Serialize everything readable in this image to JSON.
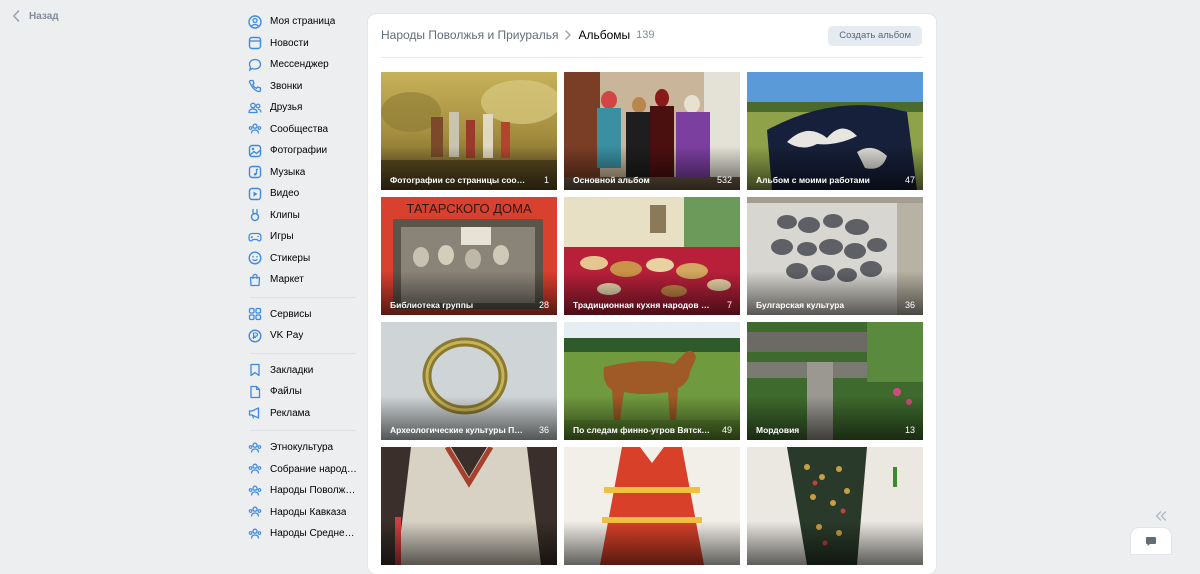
{
  "back": {
    "label": "Назад"
  },
  "sidebar": {
    "groups": [
      [
        {
          "label": "Моя страница",
          "icon": "user-circle-icon"
        },
        {
          "label": "Новости",
          "icon": "news-icon"
        },
        {
          "label": "Мессенджер",
          "icon": "message-icon"
        },
        {
          "label": "Звонки",
          "icon": "phone-icon"
        },
        {
          "label": "Друзья",
          "icon": "friends-icon"
        },
        {
          "label": "Сообщества",
          "icon": "communities-icon"
        },
        {
          "label": "Фотографии",
          "icon": "photo-icon"
        },
        {
          "label": "Музыка",
          "icon": "music-icon"
        },
        {
          "label": "Видео",
          "icon": "video-icon"
        },
        {
          "label": "Клипы",
          "icon": "clips-icon"
        },
        {
          "label": "Игры",
          "icon": "gamepad-icon"
        },
        {
          "label": "Стикеры",
          "icon": "smile-icon"
        },
        {
          "label": "Маркет",
          "icon": "shopping-bag-icon"
        }
      ],
      [
        {
          "label": "Сервисы",
          "icon": "services-icon"
        },
        {
          "label": "VK Pay",
          "icon": "vkpay-icon"
        }
      ],
      [
        {
          "label": "Закладки",
          "icon": "bookmark-icon"
        },
        {
          "label": "Файлы",
          "icon": "file-icon"
        },
        {
          "label": "Реклама",
          "icon": "megaphone-icon"
        }
      ],
      [
        {
          "label": "Этнокультура",
          "icon": "group-icon"
        },
        {
          "label": "Собрание народн...",
          "icon": "group-icon"
        },
        {
          "label": "Народы Поволжья...",
          "icon": "group-icon"
        },
        {
          "label": "Народы Кавказа",
          "icon": "group-icon"
        },
        {
          "label": "Народы Средней ...",
          "icon": "group-icon"
        }
      ]
    ]
  },
  "header": {
    "community": "Народы Поволжья и Приуралья",
    "section": "Альбомы",
    "count": "139",
    "create_button": "Создать альбом"
  },
  "albums": [
    {
      "title": "Фотографии со страницы сообщества",
      "count": "1"
    },
    {
      "title": "Основной альбом",
      "count": "532"
    },
    {
      "title": "Альбом с моими работами",
      "count": "47"
    },
    {
      "title": "Библиотека группы",
      "count": "28"
    },
    {
      "title": "Традиционная кухня народов Поволжья",
      "count": "7"
    },
    {
      "title": "Булгарская культура",
      "count": "36"
    },
    {
      "title": "Археологические культуры Поволжья",
      "count": "36"
    },
    {
      "title": "По следам финно-угров Вятского края",
      "count": "49"
    },
    {
      "title": "Мордовия",
      "count": "13"
    },
    {
      "title": "",
      "count": ""
    },
    {
      "title": "",
      "count": ""
    },
    {
      "title": "",
      "count": ""
    }
  ],
  "colors": {
    "background": "#edeef0",
    "card": "#ffffff",
    "nav_icon": "#3f8ae0",
    "muted": "#818c99",
    "button_bg": "#e5ebf1",
    "button_text": "#55677d"
  }
}
